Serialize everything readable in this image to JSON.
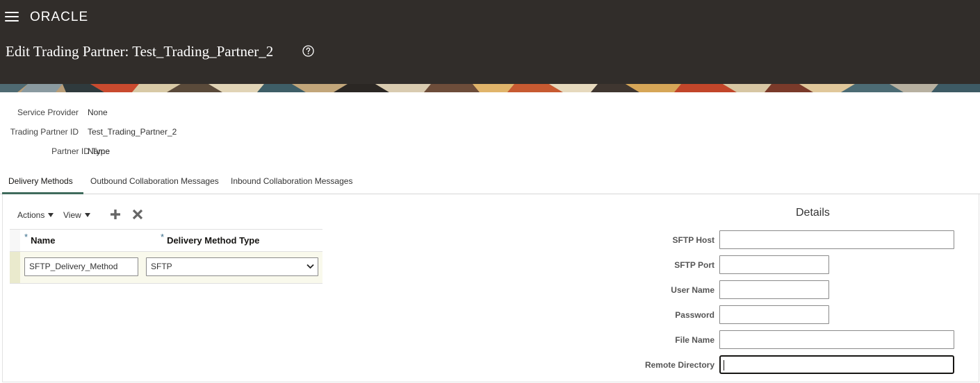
{
  "header": {
    "logo_text": "ORACLE",
    "page_title": "Edit Trading Partner: Test_Trading_Partner_2",
    "bg_color": "#312d2a"
  },
  "info": {
    "service_provider_label": "Service Provider",
    "service_provider_value": "None",
    "trading_partner_id_label": "Trading Partner ID",
    "trading_partner_id_value": "Test_Trading_Partner_2",
    "partner_id_type_label": "Partner ID Type",
    "partner_id_type_value": "Name"
  },
  "tabs": [
    {
      "label": "Delivery Methods",
      "active": true
    },
    {
      "label": "Outbound Collaboration Messages",
      "active": false
    },
    {
      "label": "Inbound Collaboration Messages",
      "active": false
    }
  ],
  "toolbar": {
    "actions_label": "Actions",
    "view_label": "View"
  },
  "table": {
    "required_mark": "*",
    "columns": [
      "Name",
      "Delivery Method Type"
    ],
    "rows": [
      {
        "name": "SFTP_Delivery_Method",
        "delivery_method_type": "SFTP"
      }
    ]
  },
  "details": {
    "title": "Details",
    "fields": [
      {
        "label": "SFTP Host",
        "value": ""
      },
      {
        "label": "SFTP Port",
        "value": ""
      },
      {
        "label": "User Name",
        "value": ""
      },
      {
        "label": "Password",
        "value": ""
      },
      {
        "label": "File Name",
        "value": ""
      },
      {
        "label": "Remote Directory",
        "value": ""
      }
    ]
  }
}
